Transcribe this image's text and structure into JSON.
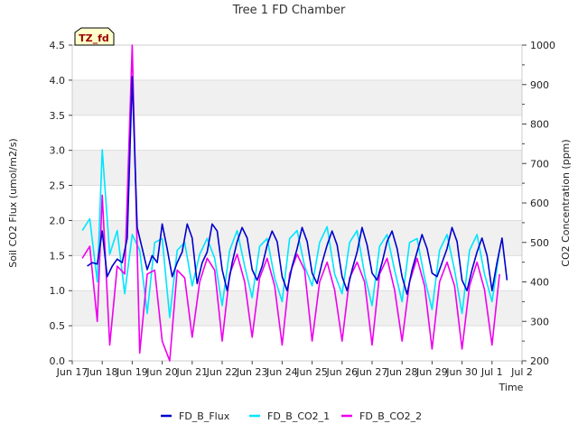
{
  "chart_data": {
    "type": "line",
    "title": "Tree 1 FD Chamber",
    "xlabel": "Time",
    "ylabel_left": "Soil CO2 Flux (umol/m2/s)",
    "ylabel_right": "CO2 Concentration (ppm)",
    "badge": "TZ_fd",
    "x_ticks": [
      "Jun 17",
      "Jun 18",
      "Jun 19",
      "Jun 20",
      "Jun 21",
      "Jun 22",
      "Jun 23",
      "Jun 24",
      "Jun 25",
      "Jun 26",
      "Jun 27",
      "Jun 28",
      "Jun 29",
      "Jun 30",
      "Jul 1",
      "Jul 2"
    ],
    "x_tick_labels": [
      "Jun 17",
      "Jun 18",
      "Jun 19",
      "Jun 20",
      "Jun 21",
      "Jun 22",
      "Jun 23",
      "Jun 24",
      "Jun 25",
      "Jun 26",
      "Jun 27",
      "Jun 28",
      "Jun 29",
      "Jun 30",
      "Jul 1",
      "Jul 2"
    ],
    "ylim_left": [
      0,
      4.5
    ],
    "left_ticks": [
      "0.0",
      "0.5",
      "1.0",
      "1.5",
      "2.0",
      "2.5",
      "3.0",
      "3.5",
      "4.0",
      "4.5"
    ],
    "ylim_right": [
      200,
      1000
    ],
    "right_ticks": [
      "200",
      "300",
      "400",
      "500",
      "600",
      "700",
      "800",
      "900",
      "1000"
    ],
    "grid": true,
    "legend_position": "bottom",
    "series": [
      {
        "name": "FD_B_Flux",
        "axis": "left",
        "color": "#0000cc",
        "x": [
          "Jun 17 12:00",
          "Jun 17 16:00",
          "Jun 17 20:00",
          "Jun 18 00:00",
          "Jun 18 04:00",
          "Jun 18 08:00",
          "Jun 18 12:00",
          "Jun 18 16:00",
          "Jun 18 20:00",
          "Jun 19 00:00",
          "Jun 19 04:00",
          "Jun 19 08:00",
          "Jun 19 12:00",
          "Jun 19 16:00",
          "Jun 19 20:00",
          "Jun 20 00:00",
          "Jun 20 04:00",
          "Jun 20 08:00",
          "Jun 20 12:00",
          "Jun 20 16:00",
          "Jun 20 20:00",
          "Jun 21 00:00",
          "Jun 21 04:00",
          "Jun 21 08:00",
          "Jun 21 12:00",
          "Jun 21 16:00",
          "Jun 21 20:00",
          "Jun 22 00:00",
          "Jun 22 04:00",
          "Jun 22 08:00",
          "Jun 22 12:00",
          "Jun 22 16:00",
          "Jun 22 20:00",
          "Jun 23 00:00",
          "Jun 23 04:00",
          "Jun 23 08:00",
          "Jun 23 12:00",
          "Jun 23 16:00",
          "Jun 23 20:00",
          "Jun 24 00:00",
          "Jun 24 04:00",
          "Jun 24 08:00",
          "Jun 24 12:00",
          "Jun 24 16:00",
          "Jun 24 20:00",
          "Jun 25 00:00",
          "Jun 25 04:00",
          "Jun 25 08:00",
          "Jun 25 12:00",
          "Jun 25 16:00",
          "Jun 25 20:00",
          "Jun 26 00:00",
          "Jun 26 04:00",
          "Jun 26 08:00",
          "Jun 26 12:00",
          "Jun 26 16:00",
          "Jun 26 20:00",
          "Jun 27 00:00",
          "Jun 27 04:00",
          "Jun 27 08:00",
          "Jun 27 12:00",
          "Jun 27 16:00",
          "Jun 27 20:00",
          "Jun 28 00:00",
          "Jun 28 04:00",
          "Jun 28 08:00",
          "Jun 28 12:00",
          "Jun 28 16:00",
          "Jun 28 20:00",
          "Jun 29 00:00",
          "Jun 29 04:00",
          "Jun 29 08:00",
          "Jun 29 12:00",
          "Jun 29 16:00",
          "Jun 29 20:00",
          "Jun 30 00:00",
          "Jun 30 04:00",
          "Jun 30 08:00",
          "Jun 30 12:00",
          "Jun 30 16:00",
          "Jun 30 20:00",
          "Jul 1 00:00",
          "Jul 1 04:00",
          "Jul 1 08:00",
          "Jul 1 12:00"
        ],
        "values": [
          1.35,
          1.4,
          1.38,
          1.85,
          1.2,
          1.35,
          1.45,
          1.4,
          1.75,
          4.05,
          1.9,
          1.6,
          1.3,
          1.5,
          1.4,
          1.95,
          1.6,
          1.2,
          1.4,
          1.55,
          1.95,
          1.75,
          1.1,
          1.4,
          1.55,
          1.95,
          1.85,
          1.3,
          1.0,
          1.4,
          1.7,
          1.9,
          1.75,
          1.3,
          1.15,
          1.35,
          1.65,
          1.85,
          1.7,
          1.2,
          1.0,
          1.35,
          1.6,
          1.9,
          1.7,
          1.25,
          1.1,
          1.4,
          1.65,
          1.85,
          1.65,
          1.2,
          1.0,
          1.3,
          1.55,
          1.9,
          1.65,
          1.25,
          1.15,
          1.4,
          1.7,
          1.85,
          1.6,
          1.2,
          0.95,
          1.3,
          1.55,
          1.8,
          1.6,
          1.25,
          1.2,
          1.4,
          1.6,
          1.9,
          1.7,
          1.15,
          1.0,
          1.3,
          1.55,
          1.75,
          1.5,
          1.0,
          1.4,
          1.75,
          1.15
        ]
      },
      {
        "name": "FD_B_CO2_1",
        "axis": "right",
        "color": "#00e5ff",
        "x": [
          "Jun 17 08:00",
          "Jun 17 14:00",
          "Jun 17 20:00",
          "Jun 18 00:00",
          "Jun 18 06:00",
          "Jun 18 12:00",
          "Jun 18 18:00",
          "Jun 19 00:00",
          "Jun 19 06:00",
          "Jun 19 12:00",
          "Jun 19 18:00",
          "Jun 20 00:00",
          "Jun 20 06:00",
          "Jun 20 12:00",
          "Jun 20 18:00",
          "Jun 21 00:00",
          "Jun 21 06:00",
          "Jun 21 12:00",
          "Jun 21 18:00",
          "Jun 22 00:00",
          "Jun 22 06:00",
          "Jun 22 12:00",
          "Jun 22 18:00",
          "Jun 23 00:00",
          "Jun 23 06:00",
          "Jun 23 12:00",
          "Jun 23 18:00",
          "Jun 24 00:00",
          "Jun 24 06:00",
          "Jun 24 12:00",
          "Jun 24 18:00",
          "Jun 25 00:00",
          "Jun 25 06:00",
          "Jun 25 12:00",
          "Jun 25 18:00",
          "Jun 26 00:00",
          "Jun 26 06:00",
          "Jun 26 12:00",
          "Jun 26 18:00",
          "Jun 27 00:00",
          "Jun 27 06:00",
          "Jun 27 12:00",
          "Jun 27 18:00",
          "Jun 28 00:00",
          "Jun 28 06:00",
          "Jun 28 12:00",
          "Jun 28 18:00",
          "Jun 29 00:00",
          "Jun 29 06:00",
          "Jun 29 12:00",
          "Jun 29 18:00",
          "Jun 30 00:00",
          "Jun 30 06:00",
          "Jun 30 12:00",
          "Jun 30 18:00",
          "Jul 1 00:00",
          "Jul 1 06:00"
        ],
        "values": [
          530,
          560,
          400,
          735,
          470,
          530,
          370,
          520,
          480,
          320,
          500,
          510,
          310,
          480,
          500,
          390,
          470,
          510,
          460,
          340,
          480,
          530,
          440,
          360,
          490,
          510,
          410,
          350,
          510,
          530,
          440,
          390,
          500,
          540,
          420,
          370,
          500,
          530,
          420,
          340,
          490,
          520,
          430,
          350,
          500,
          510,
          410,
          330,
          480,
          520,
          430,
          320,
          480,
          520,
          420,
          350,
          480
        ]
      },
      {
        "name": "FD_B_CO2_2",
        "axis": "right",
        "color": "#ee00ee",
        "x": [
          "Jun 17 08:00",
          "Jun 17 14:00",
          "Jun 17 20:00",
          "Jun 18 00:00",
          "Jun 18 06:00",
          "Jun 18 12:00",
          "Jun 18 18:00",
          "Jun 19 00:00",
          "Jun 19 06:00",
          "Jun 19 12:00",
          "Jun 19 18:00",
          "Jun 20 00:00",
          "Jun 20 06:00",
          "Jun 20 12:00",
          "Jun 20 18:00",
          "Jun 21 00:00",
          "Jun 21 06:00",
          "Jun 21 12:00",
          "Jun 21 18:00",
          "Jun 22 00:00",
          "Jun 22 06:00",
          "Jun 22 12:00",
          "Jun 22 18:00",
          "Jun 23 00:00",
          "Jun 23 06:00",
          "Jun 23 12:00",
          "Jun 23 18:00",
          "Jun 24 00:00",
          "Jun 24 06:00",
          "Jun 24 12:00",
          "Jun 24 18:00",
          "Jun 25 00:00",
          "Jun 25 06:00",
          "Jun 25 12:00",
          "Jun 25 18:00",
          "Jun 26 00:00",
          "Jun 26 06:00",
          "Jun 26 12:00",
          "Jun 26 18:00",
          "Jun 27 00:00",
          "Jun 27 06:00",
          "Jun 27 12:00",
          "Jun 27 18:00",
          "Jun 28 00:00",
          "Jun 28 06:00",
          "Jun 28 12:00",
          "Jun 28 18:00",
          "Jun 29 00:00",
          "Jun 29 06:00",
          "Jun 29 12:00",
          "Jun 29 18:00",
          "Jun 30 00:00",
          "Jun 30 06:00",
          "Jun 30 12:00",
          "Jun 30 18:00",
          "Jul 1 00:00",
          "Jul 1 06:00"
        ],
        "values": [
          460,
          490,
          300,
          620,
          240,
          440,
          420,
          1000,
          220,
          420,
          430,
          250,
          200,
          430,
          410,
          260,
          400,
          460,
          430,
          250,
          420,
          470,
          400,
          260,
          410,
          460,
          390,
          240,
          420,
          470,
          430,
          250,
          400,
          450,
          380,
          250,
          410,
          450,
          400,
          240,
          420,
          460,
          380,
          250,
          400,
          460,
          390,
          230,
          400,
          450,
          390,
          230,
          390,
          450,
          380,
          240,
          420
        ]
      }
    ]
  }
}
